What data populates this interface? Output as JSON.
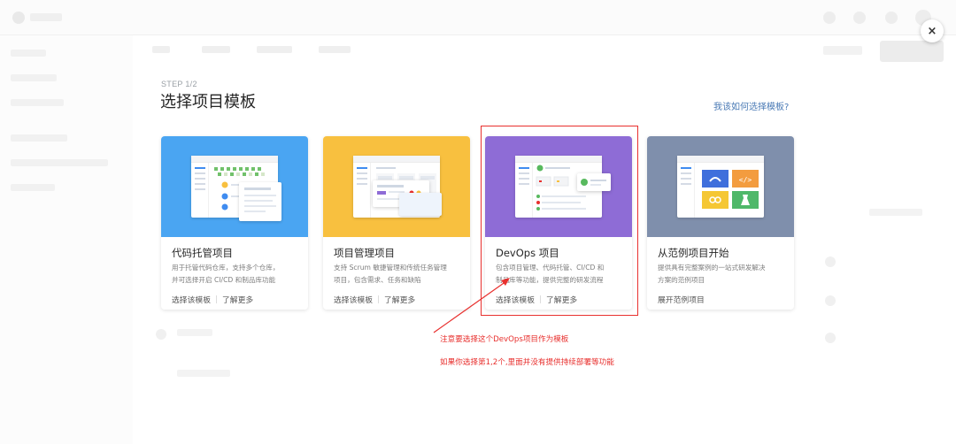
{
  "modal": {
    "close_label": "×",
    "step": "STEP 1/2",
    "title": "选择项目模板",
    "help_link": "我该如何选择模板?"
  },
  "cards": [
    {
      "name": "代码托管项目",
      "desc_line1": "用于托管代码仓库，支持多个仓库，",
      "desc_line2": "并可选择开启 CI/CD 和制品库功能",
      "action_primary": "选择该模板",
      "action_secondary": "了解更多",
      "color": "#4aa5f2"
    },
    {
      "name": "项目管理项目",
      "desc_line1": "支持 Scrum 敏捷管理和传统任务管理",
      "desc_line2": "项目，包含需求、任务和缺陷",
      "action_primary": "选择该模板",
      "action_secondary": "了解更多",
      "color": "#f8c03f"
    },
    {
      "name": "DevOps 项目",
      "desc_line1": "包含项目管理、代码托管、CI/CD 和",
      "desc_line2": "制品库等功能，提供完整的研发流程",
      "action_primary": "选择该模板",
      "action_secondary": "了解更多",
      "color": "#8e6cd6"
    },
    {
      "name": "从范例项目开始",
      "desc_line1": "提供具有完整案例的一站式研发解决",
      "desc_line2": "方案的范例项目",
      "action_primary": "展开范例项目",
      "color": "#7f8fac"
    }
  ],
  "annotation": {
    "line1": "注意要选择这个DevOps项目作为模板",
    "line2": "如果你选择第1,2个,里面并没有提供持续部署等功能",
    "color": "#e8302e"
  }
}
